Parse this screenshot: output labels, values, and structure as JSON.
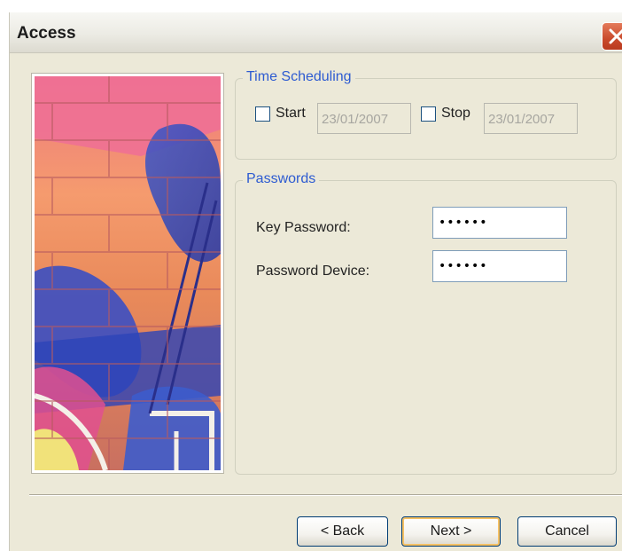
{
  "window": {
    "title": "Access"
  },
  "art": {
    "description_icon": "graffiti-brick-wall-image"
  },
  "time_scheduling": {
    "title": "Time Scheduling",
    "start": {
      "label": "Start",
      "checked": false,
      "date": "23/01/2007"
    },
    "stop": {
      "label": "Stop",
      "checked": false,
      "date": "23/01/2007"
    }
  },
  "passwords": {
    "title": "Passwords",
    "key_password": {
      "label": "Key Password:",
      "value": "••••••"
    },
    "password_device": {
      "label": "Password Device:",
      "value": "••••••"
    }
  },
  "buttons": {
    "back": "< Back",
    "next": "Next >",
    "cancel": "Cancel"
  },
  "colors": {
    "group_title": "#2d5bd1",
    "dialog_bg": "#ece9d8",
    "close_button": "#c94a2c"
  }
}
